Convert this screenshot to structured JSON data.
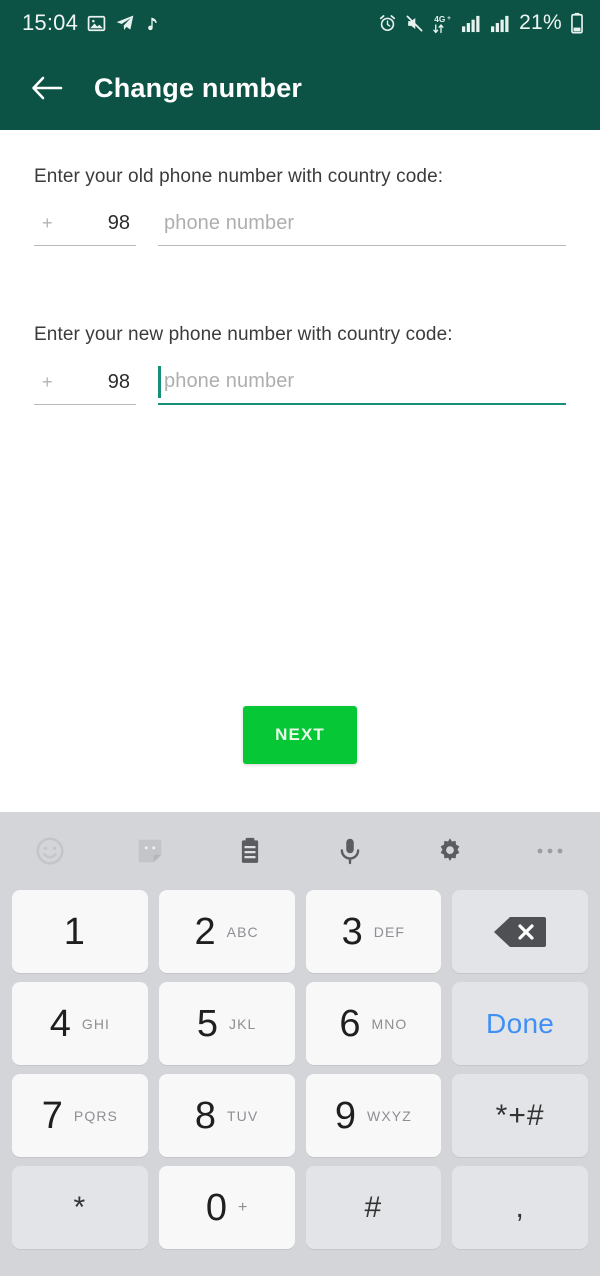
{
  "status_bar": {
    "time": "15:04",
    "battery_percent": "21%",
    "network_type": "4G+",
    "icons": [
      "photo-icon",
      "telegram-icon",
      "music-note-icon",
      "alarm-icon",
      "mute-icon",
      "network-4g-plus-icon",
      "signal-bars-sim1-icon",
      "signal-bars-sim2-icon",
      "battery-icon"
    ]
  },
  "app_bar": {
    "back_label": "back-arrow",
    "title": "Change number"
  },
  "form": {
    "old": {
      "label": "Enter your old phone number with country code:",
      "country_plus": "+",
      "country_code": "98",
      "phone_placeholder": "phone number",
      "phone_value": "",
      "focused": false
    },
    "new": {
      "label": "Enter your new phone number with country code:",
      "country_plus": "+",
      "country_code": "98",
      "phone_placeholder": "phone number",
      "phone_value": "",
      "focused": true
    },
    "next_label": "NEXT"
  },
  "colors": {
    "header_green": "#0c5345",
    "accent_green": "#14907a",
    "next_button_green": "#06c736",
    "done_blue": "#3f8ff5",
    "keyboard_bg": "#d3d5d9",
    "key_bg": "#f8f8f9",
    "fn_key_bg": "#e3e4e8"
  },
  "keyboard": {
    "toolbar": [
      {
        "name": "emoji-icon",
        "dimmed": true
      },
      {
        "name": "sticker-icon",
        "dimmed": true
      },
      {
        "name": "clipboard-icon",
        "dimmed": false
      },
      {
        "name": "microphone-icon",
        "dimmed": false
      },
      {
        "name": "gear-icon",
        "dimmed": false
      },
      {
        "name": "more-options-icon",
        "dimmed": false
      }
    ],
    "rows": [
      [
        {
          "main": "1",
          "sub": "",
          "type": "number"
        },
        {
          "main": "2",
          "sub": "ABC",
          "type": "number"
        },
        {
          "main": "3",
          "sub": "DEF",
          "type": "number"
        },
        {
          "main": "",
          "sub": "",
          "type": "backspace"
        }
      ],
      [
        {
          "main": "4",
          "sub": "GHI",
          "type": "number"
        },
        {
          "main": "5",
          "sub": "JKL",
          "type": "number"
        },
        {
          "main": "6",
          "sub": "MNO",
          "type": "number"
        },
        {
          "main": "Done",
          "sub": "",
          "type": "done"
        }
      ],
      [
        {
          "main": "7",
          "sub": "PQRS",
          "type": "number"
        },
        {
          "main": "8",
          "sub": "TUV",
          "type": "number"
        },
        {
          "main": "9",
          "sub": "WXYZ",
          "type": "number"
        },
        {
          "main": "*+#",
          "sub": "",
          "type": "symbol"
        }
      ],
      [
        {
          "main": "*",
          "sub": "",
          "type": "symbol-fn"
        },
        {
          "main": "0",
          "sub": "+",
          "type": "number"
        },
        {
          "main": "#",
          "sub": "",
          "type": "symbol-fn"
        },
        {
          "main": ",",
          "sub": "",
          "type": "symbol-fn"
        }
      ]
    ]
  }
}
